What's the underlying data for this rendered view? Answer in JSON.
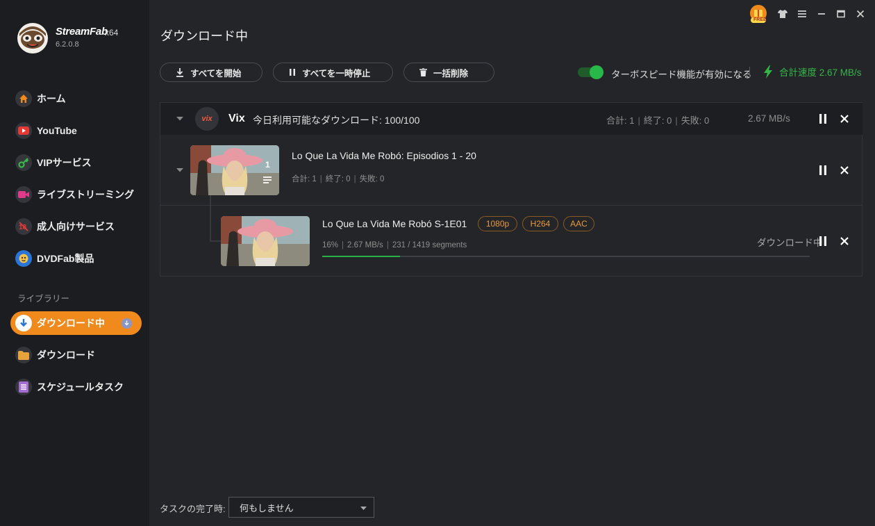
{
  "app": {
    "brand": "StreamFab",
    "arch": "x64",
    "version": "6.2.0.8"
  },
  "titlebar": {
    "free_badge": "FREE",
    "icons": [
      "free-gift-icon",
      "skin-shirt-icon",
      "menu-icon",
      "minimize-icon",
      "maximize-icon",
      "close-icon"
    ]
  },
  "sidebar": {
    "items": [
      {
        "label": "ホーム",
        "icon": "home-icon",
        "color": "#f08a1c"
      },
      {
        "label": "YouTube",
        "icon": "youtube-icon",
        "color": "#e53935"
      },
      {
        "label": "VIPサービス",
        "icon": "key-icon",
        "color": "#39b54a"
      },
      {
        "label": "ライブストリーミング",
        "icon": "video-camera-icon",
        "color": "#e03a8c"
      },
      {
        "label": "成人向けサービス",
        "icon": "adult-restricted-icon",
        "color": "#e53935"
      },
      {
        "label": "DVDFab製品",
        "icon": "dvdfab-icon",
        "color": "#2a74d8"
      }
    ],
    "library_heading": "ライブラリー",
    "library": [
      {
        "label": "ダウンロード中",
        "icon": "download-arrow-icon",
        "active": true
      },
      {
        "label": "ダウンロード",
        "icon": "folder-icon",
        "color": "#e8a23c"
      },
      {
        "label": "スケジュールタスク",
        "icon": "schedule-list-icon",
        "color": "#a46bd6"
      }
    ]
  },
  "main": {
    "title": "ダウンロード中",
    "toolbar": {
      "start_all": "すべてを開始",
      "pause_all": "すべてを一時停止",
      "delete_all": "一括削除"
    },
    "turbo": {
      "enabled": true,
      "label": "ターボスピード機能が有効になる"
    },
    "total_speed": "合計速度 2.67 MB/s",
    "group": {
      "service": "Vix",
      "service_logo_text": "vix",
      "available": "今日利用可能なダウンロード: 100/100",
      "total": "合計: 1",
      "done": "終了: 0",
      "failed": "失敗: 0",
      "speed": "2.67 MB/s",
      "series": {
        "title": "Lo Que La Vida Me Robó: Episodios 1 - 20",
        "count": "1",
        "total": "合計: 1",
        "done": "終了: 0",
        "failed": "失敗: 0"
      },
      "episode": {
        "title": "Lo Que La Vida Me Robó S-1E01",
        "tags": [
          "1080p",
          "H264",
          "AAC"
        ],
        "percent_text": "16%",
        "progress": 0.16,
        "speed": "2.67 MB/s",
        "segments": "231 / 1419 segments",
        "status": "ダウンロード中"
      }
    },
    "footer": {
      "label": "タスクの完了時:",
      "select_value": "何もしません"
    }
  }
}
